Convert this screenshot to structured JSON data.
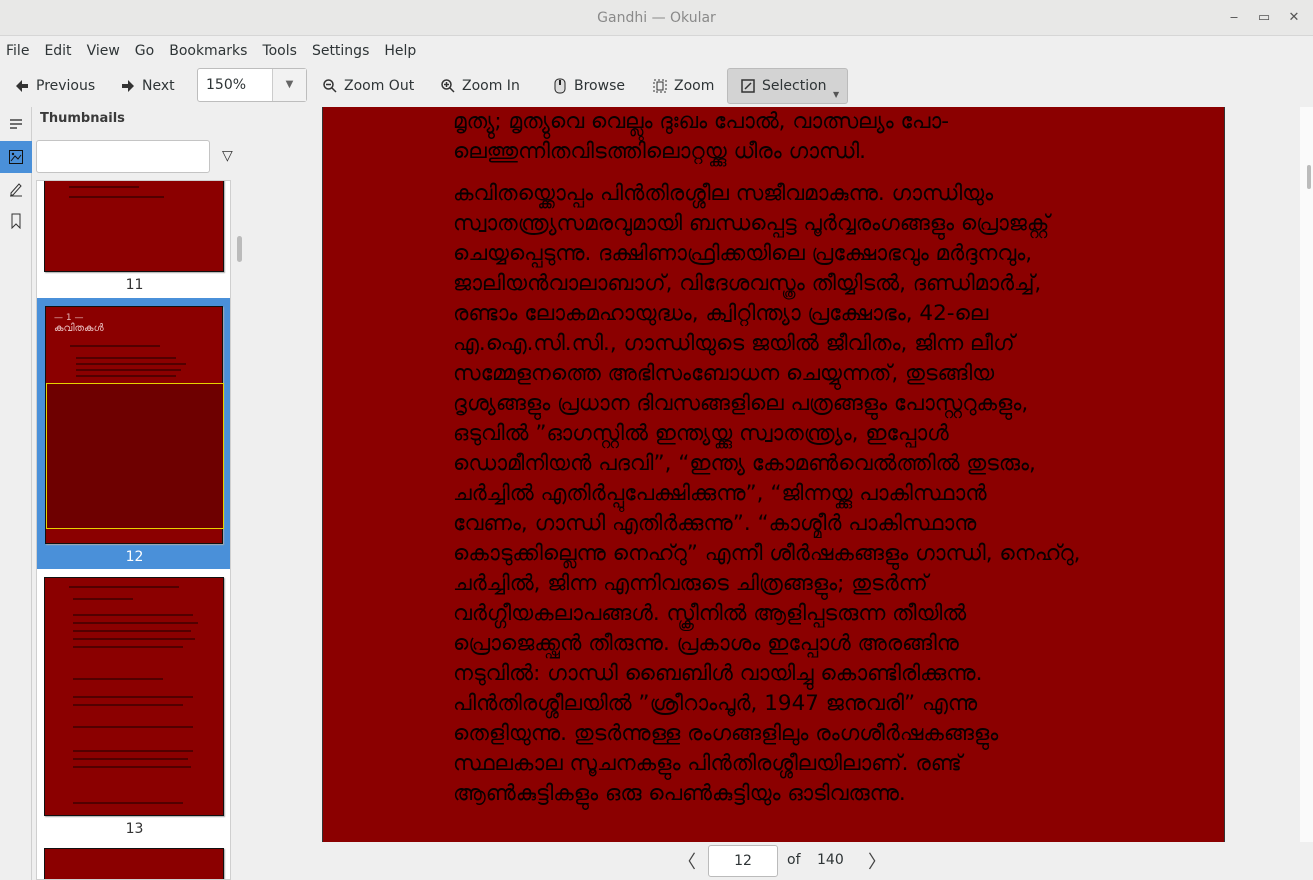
{
  "window": {
    "title": "Gandhi  — Okular",
    "minimize": "‒",
    "restore": "▭",
    "close": "✕"
  },
  "menu": [
    "File",
    "Edit",
    "View",
    "Go",
    "Bookmarks",
    "Tools",
    "Settings",
    "Help"
  ],
  "toolbar": {
    "previous": "Previous",
    "next": "Next",
    "zoom_value": "150%",
    "zoom_out": "Zoom Out",
    "zoom_in": "Zoom In",
    "browse": "Browse",
    "zoom": "Zoom",
    "selection": "Selection"
  },
  "sidebar": {
    "title": "Thumbnails",
    "search_value": "",
    "thumbnails": [
      {
        "page": "11"
      },
      {
        "page": "12",
        "selected": true,
        "heading_num": "— 1 —",
        "heading": "കവിതകൾ"
      },
      {
        "page": "13"
      }
    ]
  },
  "document": {
    "paragraphs": [
      [
        "മൃത്യു; മൃത്യുവെ വെല്ലും ദുഃഖം പോൽ, വാത്സല്യം പോ-",
        "ലെത്തുന്നിതവിടത്തിലൊറ്റയ്ക്കു ധീരം ഗാന്ധി."
      ],
      [
        "കവിതയ്ക്കൊപ്പം പിൻതിരശ്ശീല സജീവമാകുന്നു. ഗാന്ധിയും",
        "സ്വാതന്ത്ര്യസമരവുമായി ബന്ധപ്പെട്ട പൂർവ്വരംഗങ്ങളും പ്രൊജക്റ്റ്",
        "ചെയ്യപ്പെടുന്നു. ദക്ഷിണാഫ്രിക്കയിലെ പ്രക്ഷോഭവും മർദ്ദനവും,",
        "ജാലിയൻവാലാബാഗ്, വിദേശവസ്ത്രം തീയ്യിടൽ, ദണ്ഡിമാർച്ച്,",
        "രണ്ടാം ലോകമഹായുദ്ധം, ക്വിറ്റിന്ത്യാ പ്രക്ഷോഭം, 42-ലെ",
        "എ.ഐ.സി.സി., ഗാന്ധിയുടെ ജയിൽ ജീവിതം, ജിന്ന ലീഗ്",
        "സമ്മേളനത്തെ അഭിസംബോധന ചെയ്യുന്നത്, തുടങ്ങിയ",
        "ദൃശ്യങ്ങളും പ്രധാന ദിവസങ്ങളിലെ പത്രങ്ങളും പോസ്റ്ററുകളും,",
        "ഒടുവിൽ ”ഓഗസ്റ്റിൽ ഇന്ത്യയ്ക്കു സ്വാതന്ത്ര്യം, ഇപ്പോൾ",
        "ഡൊമീനിയൻ പദവി”, “ഇന്ത്യ കോമൺവെൽത്തിൽ തുടരും,",
        "ചർച്ചിൽ എതിർപ്പുപേക്ഷിക്കുന്നു”, “ജിന്നയ്ക്കു പാകിസ്ഥാൻ",
        "വേണം, ഗാന്ധി എതിർക്കുന്നു”. “കാശ്മീർ പാകിസ്ഥാനു",
        "കൊടുക്കില്ലെന്നു നെഹ്റു” എന്നീ ശീർഷകങ്ങളും ഗാന്ധി, നെഹ്റു,",
        "ചർച്ചിൽ, ജിന്ന എന്നിവരുടെ ചിത്രങ്ങളും; തുടർന്ന്",
        "വർഗ്ഗീയകലാപങ്ങൾ. സ്ക്രീനിൽ ആളിപ്പടരുന്ന തീയിൽ",
        "പ്രൊജെക്ക്ഷൻ തീരുന്നു. പ്രകാശം ഇപ്പോൾ അരങ്ങിനു",
        "നടുവിൽ: ഗാന്ധി ബൈബിൾ വായിച്ചു കൊണ്ടിരിക്കുന്നു.",
        "പിൻതിരശ്ശീലയിൽ ”ശ്രീറാംപൂർ, 1947 ജനുവരി” എന്നു",
        "തെളിയുന്നു. തുടർന്നുള്ള രംഗങ്ങളിലും രംഗശീർഷകങ്ങളും",
        "സ്ഥലകാല സൂചനകളും പിൻതിരശ്ശീലയിലാണ്. രണ്ട്",
        "ആൺകുട്ടികളും ഒരു പെൺകുട്ടിയും ഓടിവരുന്നു."
      ]
    ],
    "page_bg": "#8b0000"
  },
  "pager": {
    "current": "12",
    "of": "of",
    "total": "140"
  }
}
